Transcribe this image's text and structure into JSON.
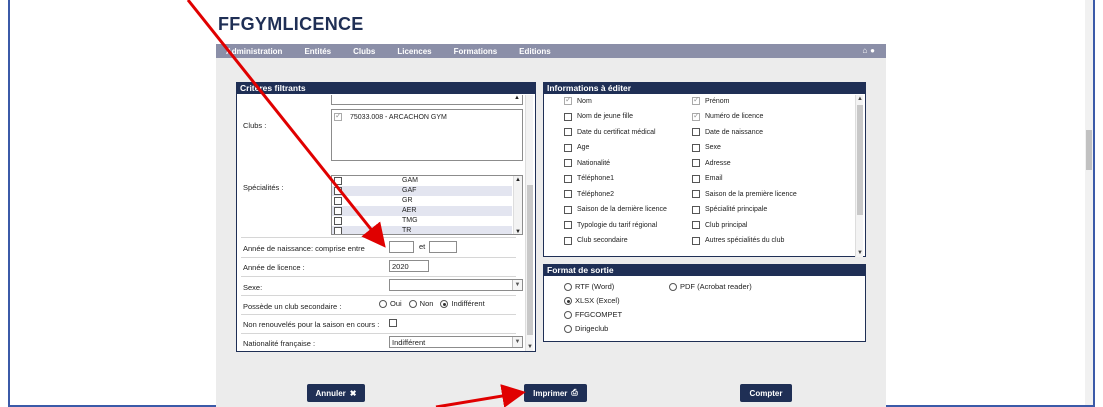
{
  "app": {
    "logo": "FFGYMLICENCE"
  },
  "nav": {
    "items": [
      "Administration",
      "Entités",
      "Clubs",
      "Licences",
      "Formations",
      "Editions"
    ],
    "icons": [
      "home-icon",
      "user-icon"
    ]
  },
  "criteria": {
    "title": "Critères filtrants",
    "clubs_label": "Clubs :",
    "clubs": [
      {
        "label": "75033.008 - ARCACHON GYM",
        "checked": true
      }
    ],
    "specialties_label": "Spécialités :",
    "specialties": [
      "GAM",
      "GAF",
      "GR",
      "AER",
      "TMG",
      "TR"
    ],
    "birth_year_label": "Année de naissance: comprise entre",
    "birth_year_from": "",
    "birth_year_and": "et",
    "birth_year_to": "",
    "licence_year_label": "Année de licence :",
    "licence_year": "2020",
    "sex_label": "Sexe:",
    "sex_value": "",
    "secondary_club_label": "Possède un club secondaire :",
    "secondary_club_options": [
      "Oui",
      "Non",
      "Indifférent"
    ],
    "secondary_club_selected": "Indifférent",
    "not_renewed_label": "Non renouvelés pour la saison en cours :",
    "nationality_label": "Nationalité française :",
    "nationality_value": "Indifférent"
  },
  "info": {
    "title": "Informations à éditer",
    "left_fields": [
      {
        "label": "Nom",
        "checked": true
      },
      {
        "label": "Nom de jeune fille",
        "checked": false
      },
      {
        "label": "Date du certificat médical",
        "checked": false
      },
      {
        "label": "Age",
        "checked": false
      },
      {
        "label": "Nationalité",
        "checked": false
      },
      {
        "label": "Téléphone1",
        "checked": false
      },
      {
        "label": "Téléphone2",
        "checked": false
      },
      {
        "label": "Saison de la dernière licence",
        "checked": false
      },
      {
        "label": "Typologie du tarif régional",
        "checked": false
      },
      {
        "label": "Club secondaire",
        "checked": false
      }
    ],
    "right_fields": [
      {
        "label": "Prénom",
        "checked": true
      },
      {
        "label": "Numéro de licence",
        "checked": true
      },
      {
        "label": "Date de naissance",
        "checked": false
      },
      {
        "label": "Sexe",
        "checked": false
      },
      {
        "label": "Adresse",
        "checked": false
      },
      {
        "label": "Email",
        "checked": false
      },
      {
        "label": "Saison de la première licence",
        "checked": false
      },
      {
        "label": "Spécialité principale",
        "checked": false
      },
      {
        "label": "Club principal",
        "checked": false
      },
      {
        "label": "Autres spécialités du club",
        "checked": false
      }
    ]
  },
  "format": {
    "title": "Format de sortie",
    "options": [
      "RTF (Word)",
      "XLSX (Excel)",
      "FFGCOMPET",
      "Dirigeclub",
      "PDF (Acrobat reader)"
    ],
    "selected": "XLSX (Excel)"
  },
  "buttons": {
    "cancel": "Annuler",
    "print": "Imprimer",
    "count": "Compter"
  },
  "colors": {
    "accent": "#1f2f55",
    "annotation_arrow": "#e00000"
  }
}
